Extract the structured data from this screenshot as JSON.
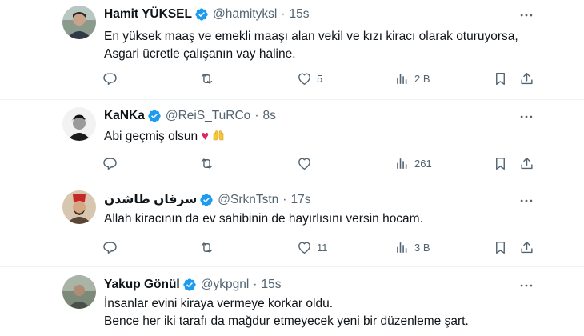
{
  "tweets": [
    {
      "name": "Hamit YÜKSEL",
      "handle": "@hamityksl",
      "time": "15s",
      "lines": [
        "En yüksek maaş ve emekli maaşı alan vekil ve kızı kiracı olarak oturuyorsa,",
        "Asgari ücretle çalışanın vay haline."
      ],
      "likes": "5",
      "views": "2 B"
    },
    {
      "name": "KaNKa",
      "handle": "@ReiS_TuRCo",
      "time": "8s",
      "lines": [
        "Abi geçmiş olsun"
      ],
      "emoji": [
        "red-heart",
        "raising-hands"
      ],
      "likes": "",
      "views": "261"
    },
    {
      "name": "سرقان طاشدن",
      "handle": "@SrknTstn",
      "time": "17s",
      "lines": [
        "Allah kiracının da ev sahibinin de hayırlısını versin hocam."
      ],
      "likes": "11",
      "views": "3 B"
    },
    {
      "name": "Yakup Gönül",
      "handle": "@ykpgnl",
      "time": "15s",
      "lines": [
        "İnsanlar evini kiraya vermeye korkar oldu.",
        "Bence her iki tarafı da mağdur etmeyecek yeni bir düzenleme şart."
      ]
    }
  ],
  "separator": "·",
  "heart_emoji": "♥",
  "colors": {
    "verified": "#1d9bf0",
    "muted": "#536471",
    "heart": "#e0245e"
  }
}
